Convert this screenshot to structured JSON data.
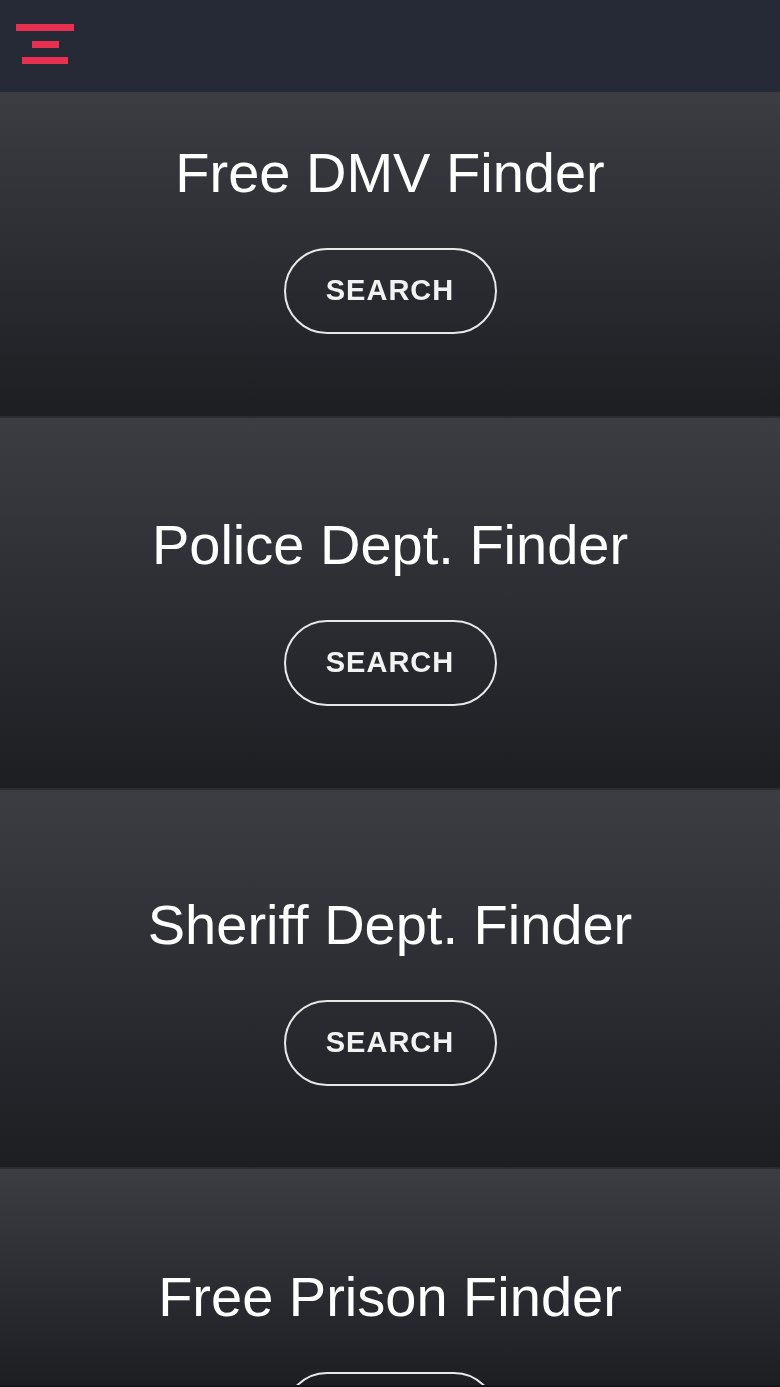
{
  "cards": [
    {
      "title": "Free DMV Finder",
      "kind": "full",
      "button": "SEARCH"
    },
    {
      "title": "Police Dept. Finder",
      "kind": "full",
      "button": "SEARCH"
    },
    {
      "title": "Sheriff Dept. Finder",
      "kind": "full",
      "button": "SEARCH"
    },
    {
      "title": "Free Prison Finder",
      "kind": "cut"
    }
  ]
}
